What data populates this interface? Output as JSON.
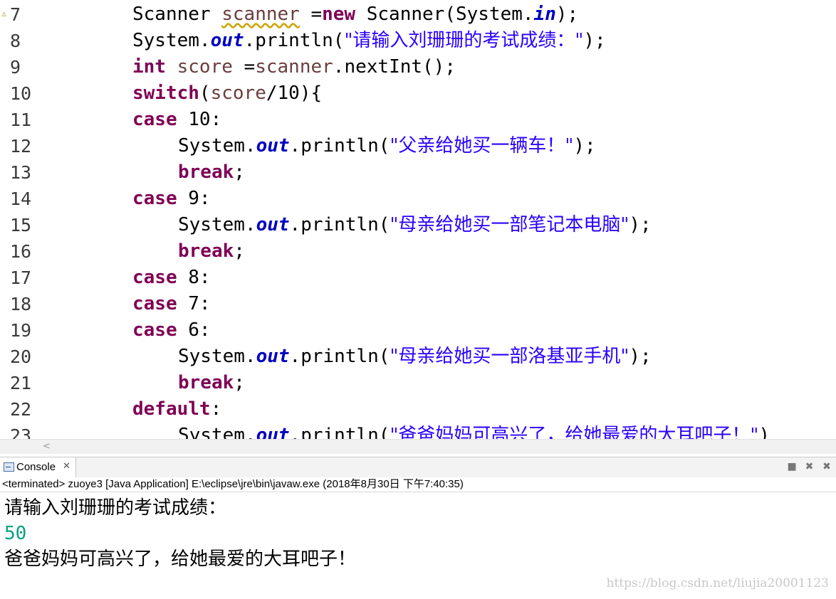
{
  "editor": {
    "lines": [
      {
        "num": "7",
        "warning": true,
        "indent": 1,
        "tokens": [
          {
            "t": "Scanner ",
            "c": "plain"
          },
          {
            "t": "scanner",
            "c": "var warn-u"
          },
          {
            "t": " =",
            "c": "plain"
          },
          {
            "t": "new",
            "c": "kw"
          },
          {
            "t": " Scanner(System.",
            "c": "plain"
          },
          {
            "t": "in",
            "c": "fld"
          },
          {
            "t": ");",
            "c": "plain"
          }
        ]
      },
      {
        "num": "8",
        "indent": 1,
        "tokens": [
          {
            "t": "System.",
            "c": "plain"
          },
          {
            "t": "out",
            "c": "fld"
          },
          {
            "t": ".println(",
            "c": "plain"
          },
          {
            "t": "\"请输入刘珊珊的考试成绩：\"",
            "c": "str"
          },
          {
            "t": ");",
            "c": "plain"
          }
        ]
      },
      {
        "num": "9",
        "indent": 1,
        "tokens": [
          {
            "t": "int",
            "c": "kw"
          },
          {
            "t": " ",
            "c": "plain"
          },
          {
            "t": "score",
            "c": "var"
          },
          {
            "t": " =",
            "c": "plain"
          },
          {
            "t": "scanner",
            "c": "var"
          },
          {
            "t": ".nextInt();",
            "c": "plain"
          }
        ]
      },
      {
        "num": "10",
        "indent": 1,
        "tokens": [
          {
            "t": "switch",
            "c": "kw"
          },
          {
            "t": "(",
            "c": "plain"
          },
          {
            "t": "score",
            "c": "var"
          },
          {
            "t": "/10){",
            "c": "plain"
          }
        ]
      },
      {
        "num": "11",
        "indent": 1,
        "tokens": [
          {
            "t": "case",
            "c": "kw"
          },
          {
            "t": " 10:",
            "c": "plain"
          }
        ]
      },
      {
        "num": "12",
        "indent": 2,
        "tokens": [
          {
            "t": "System.",
            "c": "plain"
          },
          {
            "t": "out",
            "c": "fld"
          },
          {
            "t": ".println(",
            "c": "plain"
          },
          {
            "t": "\"父亲给她买一辆车！\"",
            "c": "str"
          },
          {
            "t": ");",
            "c": "plain"
          }
        ]
      },
      {
        "num": "13",
        "indent": 2,
        "tokens": [
          {
            "t": "break",
            "c": "kw"
          },
          {
            "t": ";",
            "c": "plain"
          }
        ]
      },
      {
        "num": "14",
        "indent": 1,
        "tokens": [
          {
            "t": "case",
            "c": "kw"
          },
          {
            "t": " 9:",
            "c": "plain"
          }
        ]
      },
      {
        "num": "15",
        "indent": 2,
        "tokens": [
          {
            "t": "System.",
            "c": "plain"
          },
          {
            "t": "out",
            "c": "fld"
          },
          {
            "t": ".println(",
            "c": "plain"
          },
          {
            "t": "\"母亲给她买一部笔记本电脑\"",
            "c": "str"
          },
          {
            "t": ");",
            "c": "plain"
          }
        ]
      },
      {
        "num": "16",
        "indent": 2,
        "tokens": [
          {
            "t": "break",
            "c": "kw"
          },
          {
            "t": ";",
            "c": "plain"
          }
        ]
      },
      {
        "num": "17",
        "indent": 1,
        "tokens": [
          {
            "t": "case",
            "c": "kw"
          },
          {
            "t": " 8:",
            "c": "plain"
          }
        ]
      },
      {
        "num": "18",
        "indent": 1,
        "tokens": [
          {
            "t": "case",
            "c": "kw"
          },
          {
            "t": " 7:",
            "c": "plain"
          }
        ]
      },
      {
        "num": "19",
        "indent": 1,
        "tokens": [
          {
            "t": "case",
            "c": "kw"
          },
          {
            "t": " 6:",
            "c": "plain"
          }
        ]
      },
      {
        "num": "20",
        "indent": 2,
        "tokens": [
          {
            "t": "System.",
            "c": "plain"
          },
          {
            "t": "out",
            "c": "fld"
          },
          {
            "t": ".println(",
            "c": "plain"
          },
          {
            "t": "\"母亲给她买一部洛基亚手机\"",
            "c": "str"
          },
          {
            "t": ");",
            "c": "plain"
          }
        ]
      },
      {
        "num": "21",
        "indent": 2,
        "tokens": [
          {
            "t": "break",
            "c": "kw"
          },
          {
            "t": ";",
            "c": "plain"
          }
        ]
      },
      {
        "num": "22",
        "indent": 1,
        "tokens": [
          {
            "t": "default",
            "c": "kw"
          },
          {
            "t": ":",
            "c": "plain"
          }
        ]
      },
      {
        "num": "23",
        "indent": 2,
        "tokens": [
          {
            "t": "System.",
            "c": "plain"
          },
          {
            "t": "out",
            "c": "fld"
          },
          {
            "t": ".println(",
            "c": "plain"
          },
          {
            "t": "\"爸爸妈妈可高兴了，给她最爱的大耳吧子！\"",
            "c": "str"
          },
          {
            "t": ")",
            "c": "plain"
          }
        ]
      }
    ],
    "scroll_left_glyph": "<"
  },
  "console": {
    "tab_label": "Console",
    "close_glyph": "✕",
    "actions": [
      "■",
      "✖",
      "✖"
    ],
    "status": "<terminated> zuoye3 [Java Application] E:\\eclipse\\jre\\bin\\javaw.exe (2018年8月30日 下午7:40:35)",
    "output": [
      {
        "text": "请输入刘珊珊的考试成绩：",
        "kind": "stdout"
      },
      {
        "text": "50",
        "kind": "input"
      },
      {
        "text": "爸爸妈妈可高兴了，给她最爱的大耳吧子！",
        "kind": "stdout"
      }
    ]
  },
  "watermark": "https://blog.csdn.net/liujia20001123",
  "colors": {
    "keyword": "#7f0055",
    "field": "#0000c0",
    "string": "#2a00ff",
    "variable": "#6a3e3e",
    "console_input": "#00a080"
  }
}
